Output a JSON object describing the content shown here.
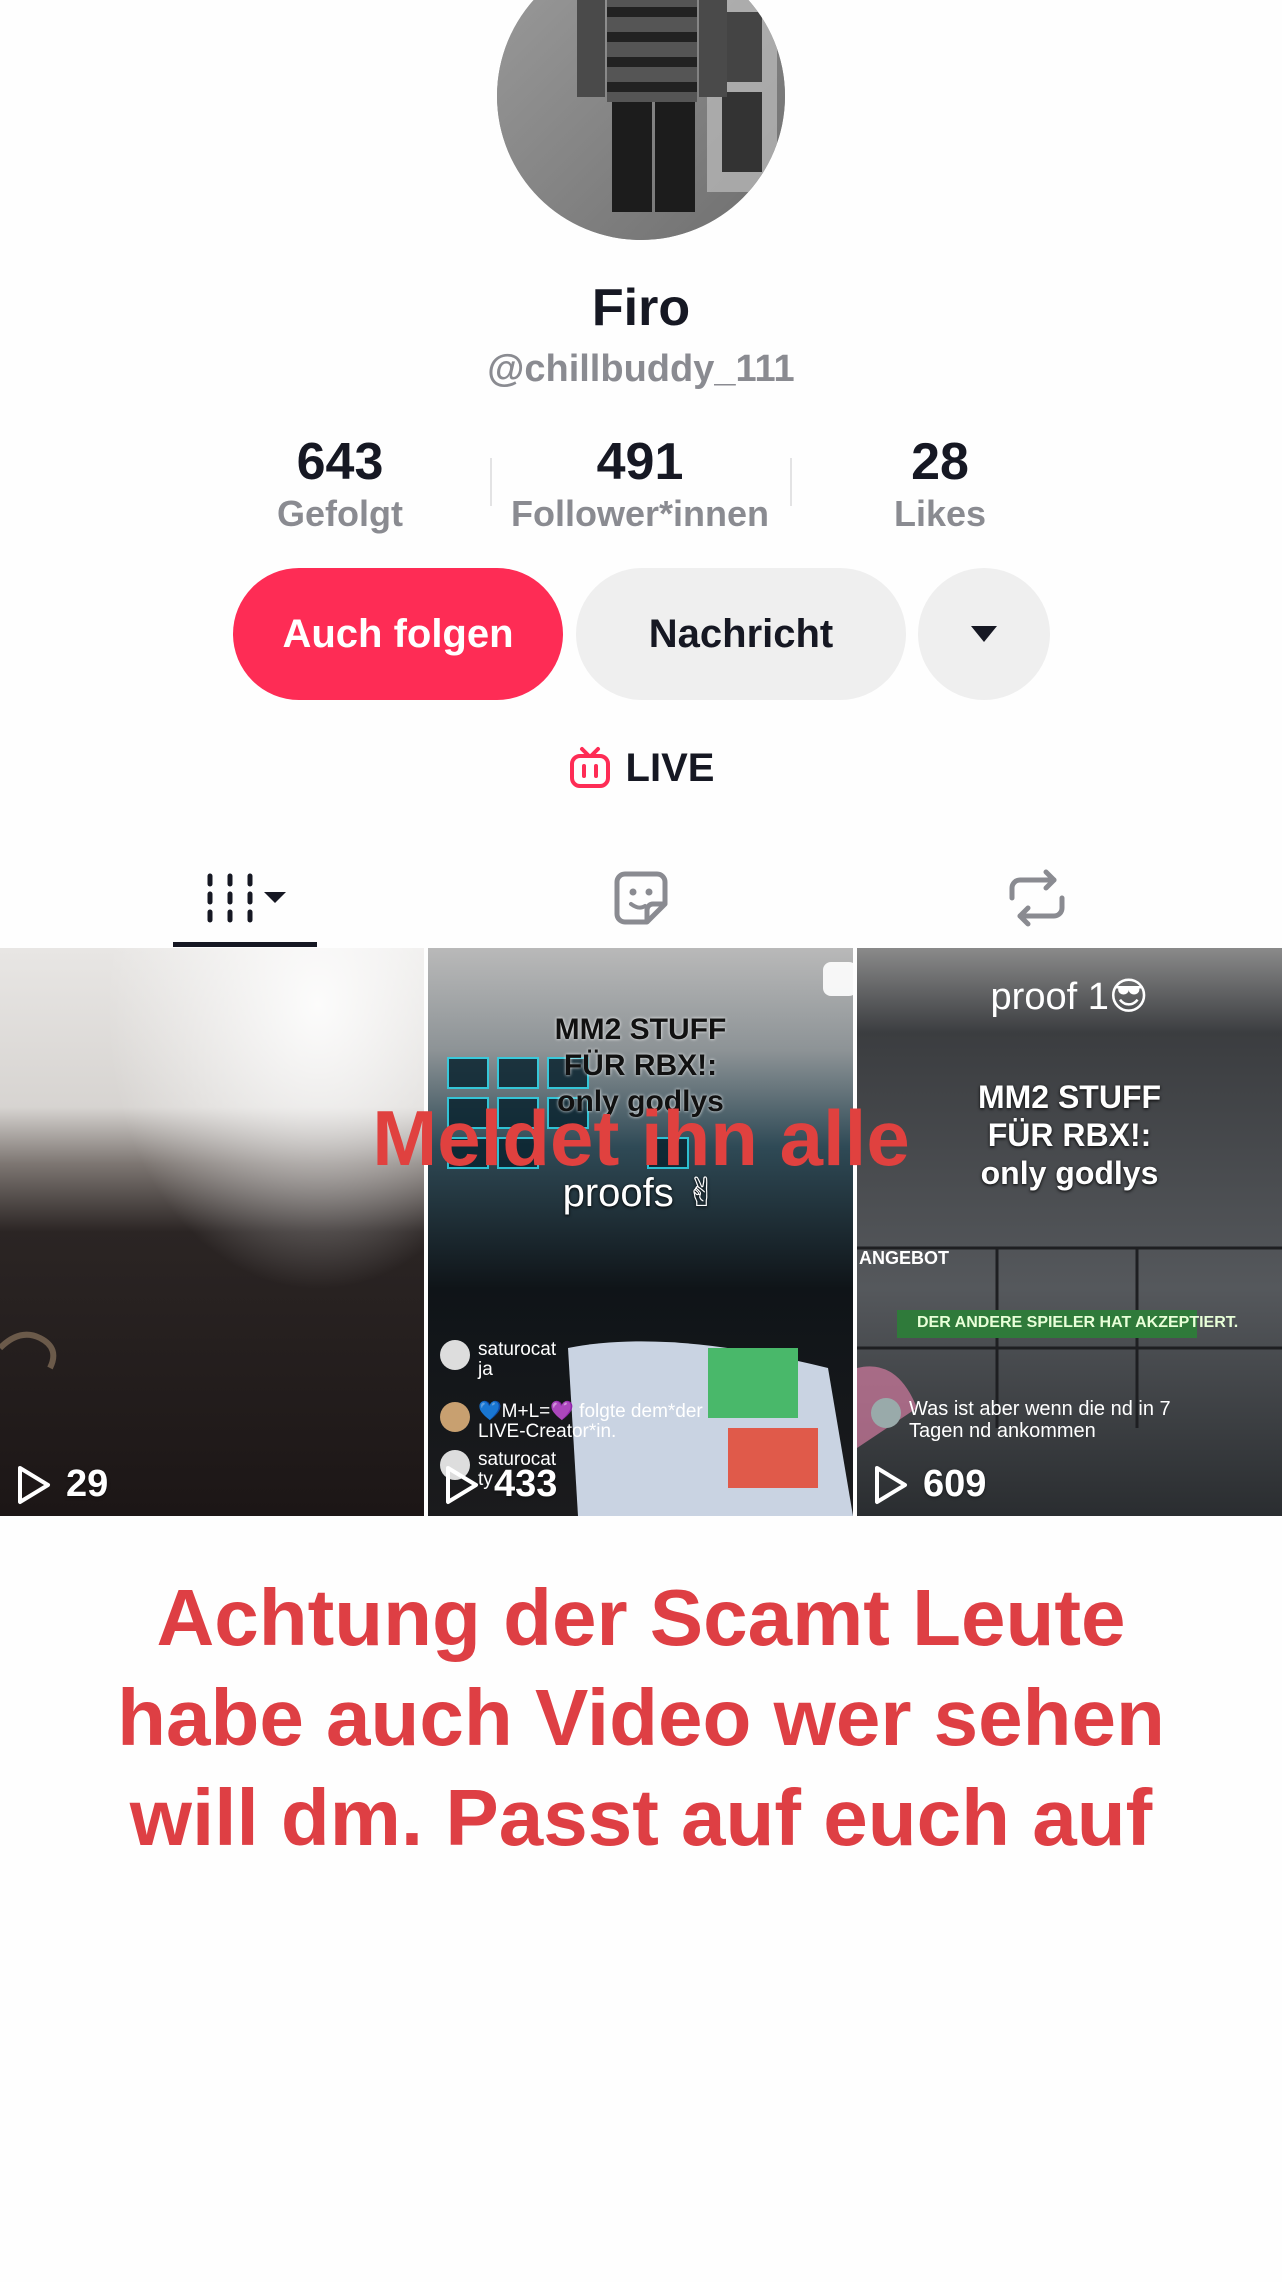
{
  "profile": {
    "name": "Firo",
    "handle": "@chillbuddy_111"
  },
  "stats": [
    {
      "value": "643",
      "label": "Gefolgt"
    },
    {
      "value": "491",
      "label": "Follower*innen"
    },
    {
      "value": "28",
      "label": "Likes"
    }
  ],
  "actions": {
    "follow_label": "Auch folgen",
    "message_label": "Nachricht"
  },
  "live": {
    "label": "LIVE"
  },
  "videos": [
    {
      "plays": "29"
    },
    {
      "plays": "433",
      "caption_line1": "MM2 STUFF",
      "caption_line2": "FÜR RBX!:",
      "caption_line3": "only godlys",
      "caption_line4": "proofs ✌",
      "comment1_user": "saturocat",
      "comment1_text": "ja",
      "comment2_text": "💙M+L=💜 folgte dem*der",
      "comment2_text2": "LIVE-Creator*in.",
      "comment3_user": "saturocat",
      "comment3_text": "ty"
    },
    {
      "plays": "609",
      "caption_top": "proof 1😎",
      "caption_line1": "MM2 STUFF",
      "caption_line2": "FÜR RBX!:",
      "caption_line3": "only godlys",
      "angebot": "ANGEBOT",
      "banner": "DER ANDERE SPIELER HAT AKZEPTIERT.",
      "comment_text1": "Was ist aber wenn die nd in 7",
      "comment_text2": "Tagen nd ankommen"
    }
  ],
  "overlay": {
    "meldet": "Meldet ihn alle",
    "warning_line1": "Achtung der Scamt Leute",
    "warning_line2": "habe auch Video wer sehen",
    "warning_line3": "will dm. Passt auf euch auf"
  },
  "colors": {
    "accent": "#fe2c55",
    "overlay_red": "#e0413f",
    "muted": "#8a8b91"
  }
}
